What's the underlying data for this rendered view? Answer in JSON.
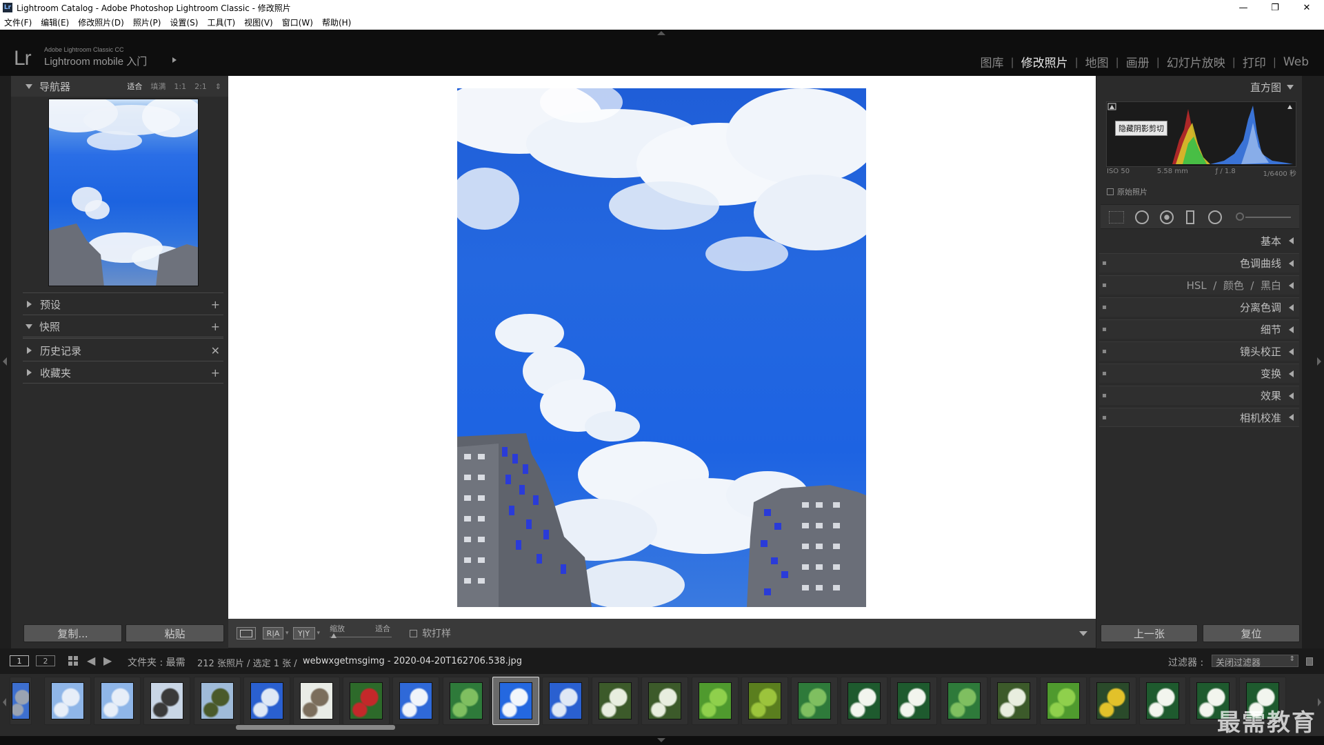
{
  "window": {
    "title": "Lightroom Catalog - Adobe Photoshop Lightroom Classic - 修改照片",
    "app_icon": "Lr",
    "controls": {
      "minimize": "—",
      "maximize": "❐",
      "close": "✕"
    }
  },
  "menu": {
    "items": [
      "文件(F)",
      "编辑(E)",
      "修改照片(D)",
      "照片(P)",
      "设置(S)",
      "工具(T)",
      "视图(V)",
      "窗口(W)",
      "帮助(H)"
    ]
  },
  "identity": {
    "logo": "Lr",
    "product": "Adobe Lightroom Classic CC",
    "mobile": "Lightroom mobile 入门"
  },
  "modules": {
    "items": [
      {
        "label": "图库",
        "active": false
      },
      {
        "label": "修改照片",
        "active": true
      },
      {
        "label": "地图",
        "active": false
      },
      {
        "label": "画册",
        "active": false
      },
      {
        "label": "幻灯片放映",
        "active": false
      },
      {
        "label": "打印",
        "active": false
      },
      {
        "label": "Web",
        "active": false
      }
    ],
    "separator": "|"
  },
  "left_panel": {
    "navigator": {
      "label": "导航器",
      "zoom": [
        "适合",
        "填满",
        "1:1",
        "2:1"
      ],
      "zoom_selected": "适合"
    },
    "presets": {
      "label": "预设",
      "action": "+"
    },
    "snapshots": {
      "label": "快照",
      "action": "+"
    },
    "history": {
      "label": "历史记录",
      "action": "✕"
    },
    "collections": {
      "label": "收藏夹",
      "action": "+"
    },
    "copy_button": "复制...",
    "paste_button": "粘贴"
  },
  "toolbar": {
    "zoom_label": "缩放",
    "zoom_value": "适合",
    "soft_proof_label": "软打样",
    "view_loupe": "",
    "view_ra": "R|A",
    "view_yy": "Y|Y"
  },
  "right_panel": {
    "histogram": {
      "label": "直方图",
      "clip_tooltip": "隐藏阴影剪切",
      "iso": "ISO 50",
      "focal": "5.58 mm",
      "aperture": "ƒ / 1.8",
      "shutter": "1/6400 秒",
      "original_photo": "原始照片"
    },
    "sections": [
      {
        "label": "基本",
        "switch": false
      },
      {
        "label": "色调曲线",
        "switch": true
      },
      {
        "label": "HSL  /  颜色  /  黑白",
        "switch": true
      },
      {
        "label": "分离色调",
        "switch": true
      },
      {
        "label": "细节",
        "switch": true
      },
      {
        "label": "镜头校正",
        "switch": true
      },
      {
        "label": "变换",
        "switch": true
      },
      {
        "label": "效果",
        "switch": true
      },
      {
        "label": "相机校准",
        "switch": true
      }
    ],
    "prev_button": "上一张",
    "reset_button": "复位"
  },
  "filmstrip_header": {
    "monitor1": "1",
    "monitor2": "2",
    "source": "文件夹 : 最需",
    "count": "212 张照片 / 选定 1 张 /",
    "filename": "webwxgetmsgimg - 2020-04-20T162706.538.jpg",
    "filter_label": "过滤器 :",
    "filter_value": "关闭过滤器"
  },
  "filmstrip": {
    "thumbnails": [
      {
        "kind": "sky-building",
        "selected": false
      },
      {
        "kind": "sky-branches",
        "selected": false
      },
      {
        "kind": "sky-branches",
        "selected": false
      },
      {
        "kind": "tree-dark",
        "selected": false
      },
      {
        "kind": "tree-green",
        "selected": false
      },
      {
        "kind": "sky-blue",
        "selected": false
      },
      {
        "kind": "buildings",
        "selected": false
      },
      {
        "kind": "red-flowers",
        "selected": false
      },
      {
        "kind": "sky-cloud",
        "selected": false
      },
      {
        "kind": "green-leaves",
        "selected": false
      },
      {
        "kind": "sky-current",
        "selected": true
      },
      {
        "kind": "sky-blue",
        "selected": false
      },
      {
        "kind": "white-flowers",
        "selected": false
      },
      {
        "kind": "white-flowers",
        "selected": false
      },
      {
        "kind": "green-grass",
        "selected": false
      },
      {
        "kind": "green-field",
        "selected": false
      },
      {
        "kind": "green-leaves",
        "selected": false
      },
      {
        "kind": "white-blossom",
        "selected": false
      },
      {
        "kind": "white-blossom",
        "selected": false
      },
      {
        "kind": "green-leaves",
        "selected": false
      },
      {
        "kind": "white-flowers",
        "selected": false
      },
      {
        "kind": "green-grass",
        "selected": false
      },
      {
        "kind": "yellow-flowers",
        "selected": false
      },
      {
        "kind": "white-blossom",
        "selected": false
      },
      {
        "kind": "white-blossom",
        "selected": false
      },
      {
        "kind": "white-blossom",
        "selected": false
      }
    ]
  },
  "watermark": "最需教育",
  "colors": {
    "panel_bg": "#2b2b2b",
    "top_bg": "#0e0e0e",
    "active_text": "#e8e8e8",
    "sky_blue": "#1f62e0"
  }
}
